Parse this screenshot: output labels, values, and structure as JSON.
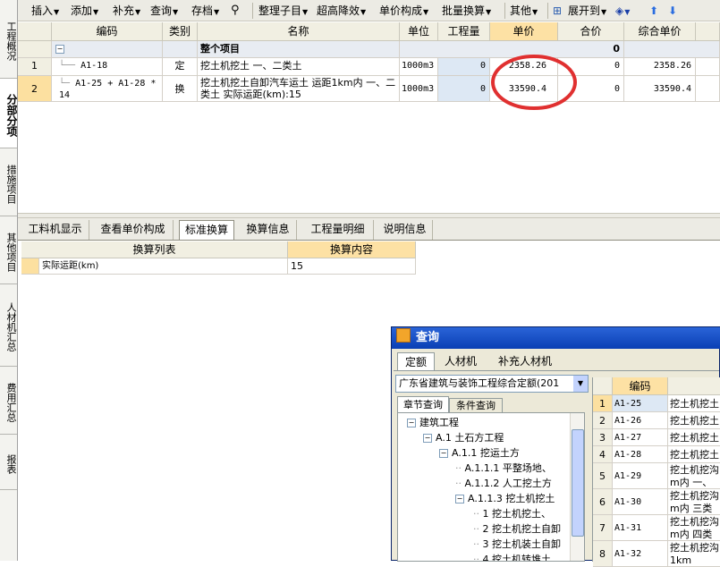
{
  "leftnav": [
    {
      "label": "工程概况"
    },
    {
      "label": "分部分项"
    },
    {
      "label": "措施项目"
    },
    {
      "label": "其他项目"
    },
    {
      "label": "人材机汇总"
    },
    {
      "label": "费用汇总"
    },
    {
      "label": "报表"
    }
  ],
  "toolbar": {
    "insert": "插入",
    "add": "添加",
    "supplement": "补充",
    "query": "查询",
    "archive": "存档",
    "organize": "整理子目",
    "over_height": "超高降效",
    "unit_price": "单价构成",
    "batch": "批量换算",
    "other": "其他",
    "expand": "展开到"
  },
  "table": {
    "headers": [
      "编码",
      "类别",
      "名称",
      "单位",
      "工程量",
      "单价",
      "合价",
      "综合单价"
    ],
    "group": {
      "toggle": "−",
      "name": "整个项目",
      "total": "0"
    },
    "rows": [
      {
        "num": "1",
        "code": "A1-18",
        "type": "定",
        "name": "挖土机挖土 一、二类土",
        "unit": "1000m3",
        "qty": "0",
        "price": "2358.26",
        "total": "0",
        "comp": "2358.26"
      },
      {
        "num": "2",
        "code": "A1-25 + A1-28 * 14",
        "type": "换",
        "name": "挖土机挖土自卸汽车运土 运距1km内 一、二类土   实际运距(km):15",
        "unit": "1000m3",
        "qty": "0",
        "price": "33590.4",
        "total": "0",
        "comp": "33590.4"
      }
    ]
  },
  "bottom_tabs": [
    "工料机显示",
    "查看单价构成",
    "标准换算",
    "换算信息",
    "工程量明细",
    "说明信息"
  ],
  "calc": {
    "headers": [
      "换算列表",
      "换算内容"
    ],
    "row": {
      "label": "实际运距(km)",
      "value": "15"
    }
  },
  "dialog": {
    "title": "查询",
    "tabs": [
      "定额",
      "人材机",
      "补充人材机"
    ],
    "quota_select": "广东省建筑与装饰工程综合定额(201",
    "sub_tabs": [
      "章节查询",
      "条件查询"
    ],
    "tree": [
      {
        "toggle": "−",
        "text": "建筑工程"
      },
      {
        "toggle": "−",
        "text": "A.1 土石方工程"
      },
      {
        "toggle": "−",
        "text": "A.1.1 挖运土方"
      },
      {
        "toggle": "",
        "text": "A.1.1.1 平整场地、"
      },
      {
        "toggle": "",
        "text": "A.1.1.2 人工挖土方"
      },
      {
        "toggle": "−",
        "text": "A.1.1.3 挖土机挖土"
      },
      {
        "toggle": "",
        "text": "1 挖土机挖土、"
      },
      {
        "toggle": "",
        "text": "2 挖土机挖土自卸"
      },
      {
        "toggle": "",
        "text": "3 挖土机装土自卸"
      },
      {
        "toggle": "",
        "text": "4 挖土机转堆土"
      }
    ],
    "list_header": "编码",
    "list": [
      {
        "num": "1",
        "code": "A1-25",
        "name": "挖土机挖土"
      },
      {
        "num": "2",
        "code": "A1-26",
        "name": "挖土机挖土"
      },
      {
        "num": "3",
        "code": "A1-27",
        "name": "挖土机挖土"
      },
      {
        "num": "4",
        "code": "A1-28",
        "name": "挖土机挖土"
      },
      {
        "num": "5",
        "code": "A1-29",
        "name": "挖土机挖沟",
        "name2": "m内 一、二"
      },
      {
        "num": "6",
        "code": "A1-30",
        "name": "挖土机挖沟",
        "name2": "m内 三类土"
      },
      {
        "num": "7",
        "code": "A1-31",
        "name": "挖土机挖沟",
        "name2": "m内 四类土"
      },
      {
        "num": "8",
        "code": "A1-32",
        "name": "挖土机挖沟",
        "name2": "1km"
      }
    ]
  },
  "colors": {
    "highlight": "#e03030",
    "orange_header": "#fde1a4",
    "titlebar": "#0a3fb4"
  }
}
